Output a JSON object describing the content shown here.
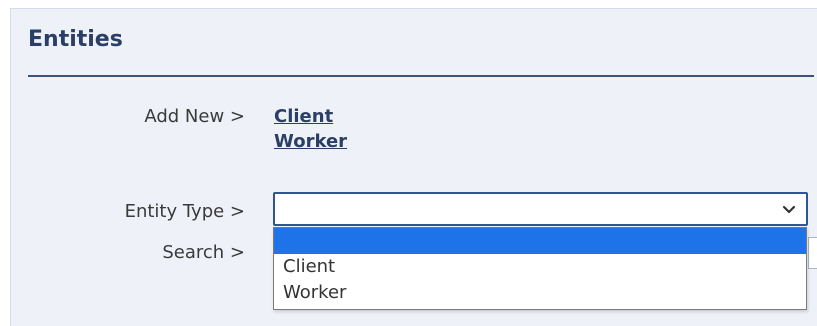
{
  "header": {
    "title": "Entities"
  },
  "form": {
    "add_new_label": "Add New >",
    "add_new_links": [
      "Client",
      "Worker"
    ],
    "entity_type_label": "Entity Type >",
    "search_label": "Search >"
  },
  "entity_type_select": {
    "selected_value": "",
    "options": [
      "",
      "Client",
      "Worker"
    ],
    "highlighted_index": 0
  },
  "icons": {
    "select_arrow": "chevron-down-icon"
  },
  "colors": {
    "panel_bg": "#eef2f8",
    "title": "#2b3f66",
    "select_border": "#2f5597",
    "highlight": "#1e73e8"
  }
}
